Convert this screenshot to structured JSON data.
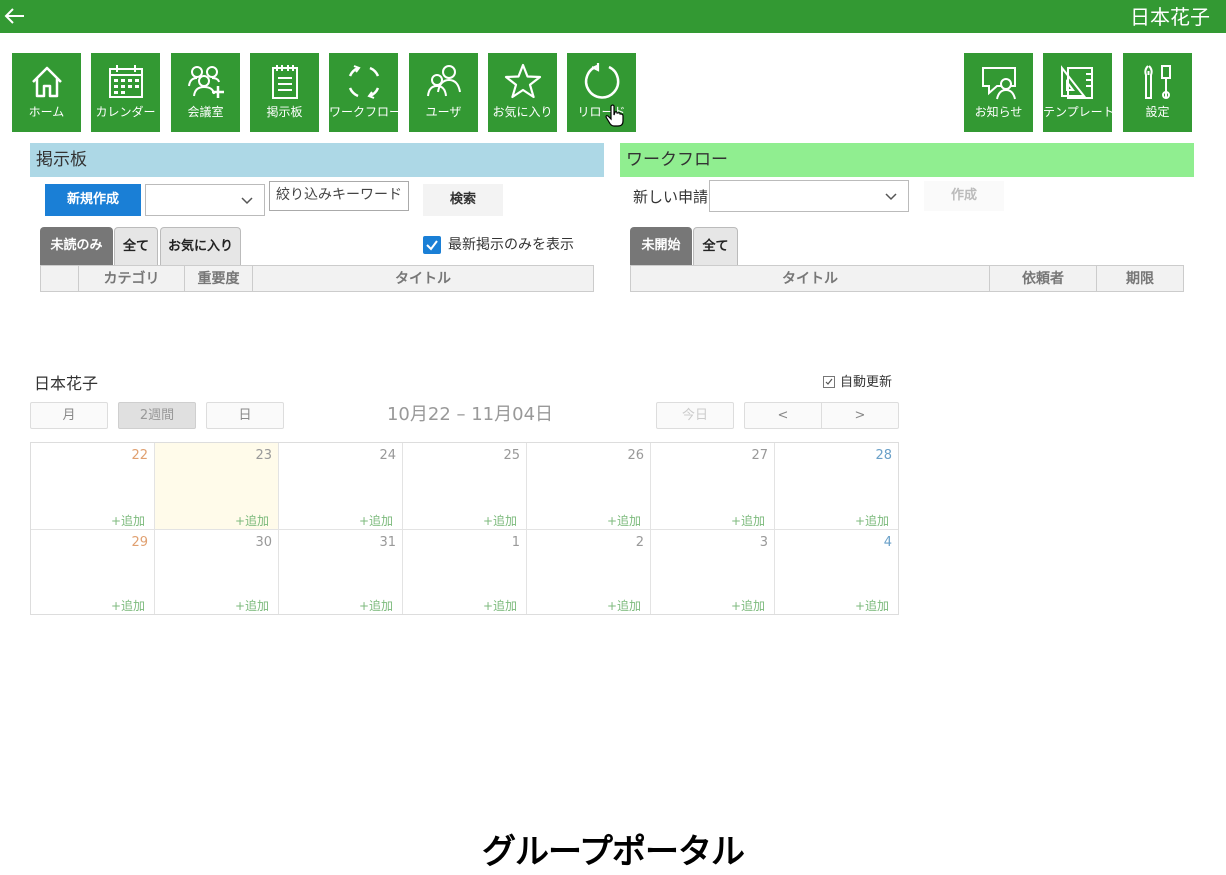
{
  "header": {
    "user_name": "日本花子"
  },
  "tiles": [
    {
      "label": "ホーム",
      "icon": "home-icon"
    },
    {
      "label": "カレンダー",
      "icon": "calendar-icon"
    },
    {
      "label": "会議室",
      "icon": "meeting-room-icon"
    },
    {
      "label": "掲示板",
      "icon": "bulletin-board-icon"
    },
    {
      "label": "ワークフロー",
      "icon": "workflow-icon"
    },
    {
      "label": "ユーザ",
      "icon": "users-icon"
    },
    {
      "label": "お気に入り",
      "icon": "star-icon"
    },
    {
      "label": "リロード",
      "icon": "reload-icon"
    },
    {
      "label": "お知らせ",
      "icon": "notice-icon"
    },
    {
      "label": "テンプレート",
      "icon": "template-icon"
    },
    {
      "label": "設定",
      "icon": "settings-icon"
    }
  ],
  "bulletin": {
    "title": "掲示板",
    "new_button": "新規作成",
    "category_value": "",
    "keyword_placeholder": "絞り込みキーワード",
    "search_button": "検索",
    "tabs": [
      "未読のみ",
      "全て",
      "お気に入り"
    ],
    "active_tab": "未読のみ",
    "latest_only_label": "最新掲示のみを表示",
    "latest_only_checked": true,
    "columns": [
      "",
      "カテゴリ",
      "重要度",
      "タイトル"
    ]
  },
  "workflow": {
    "title": "ワークフロー",
    "new_request_label": "新しい申請",
    "request_value": "",
    "create_button": "作成",
    "tabs": [
      "未開始",
      "全て"
    ],
    "active_tab": "未開始",
    "columns": [
      "タイトル",
      "依頼者",
      "期限"
    ]
  },
  "calendar": {
    "owner": "日本花子",
    "auto_update_label": "自動更新",
    "auto_update_checked": true,
    "view_buttons": [
      "月",
      "2週間",
      "日"
    ],
    "selected_view": "2週間",
    "range_title": "10月22 – 11月04日",
    "today_button": "今日",
    "prev_button": "<",
    "next_button": ">",
    "add_label": "+追加",
    "weeks": [
      [
        "22",
        "23",
        "24",
        "25",
        "26",
        "27",
        "28"
      ],
      [
        "29",
        "30",
        "31",
        "1",
        "2",
        "3",
        "4"
      ]
    ],
    "today_date": "23"
  },
  "caption": "グループポータル",
  "colors": {
    "brand_green": "#339933",
    "bulletin_header": "#add8e6",
    "workflow_header": "#90ee90",
    "primary_blue": "#1a7fd6",
    "today_highlight": "#fffbea",
    "sunday_number": "#e0a070",
    "saturday_number": "#6aa0c8"
  }
}
